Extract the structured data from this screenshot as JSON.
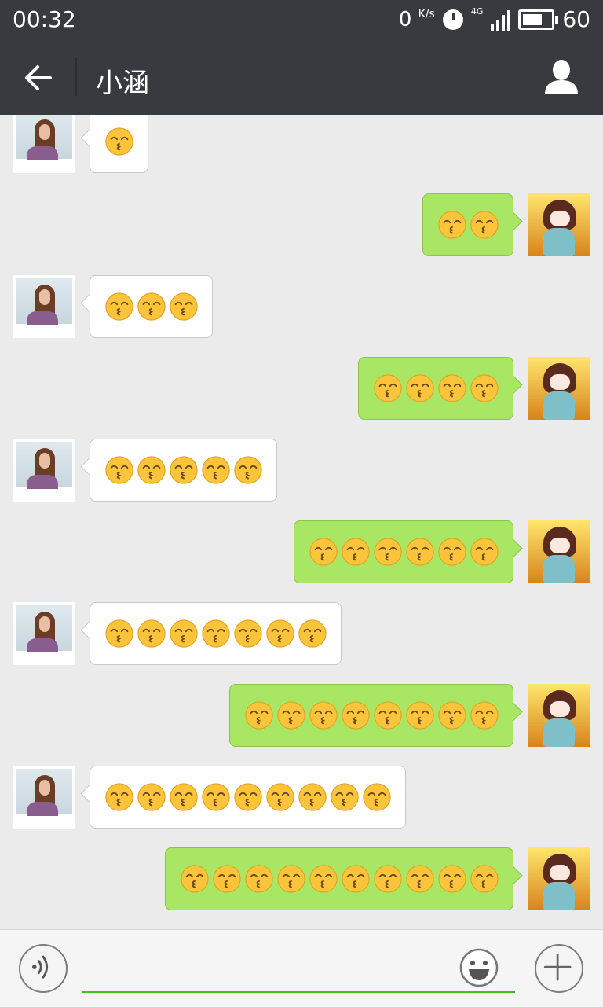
{
  "status": {
    "time": "00:32",
    "speed_value": "0",
    "speed_unit": "K/s",
    "network": "4G",
    "battery": "60"
  },
  "header": {
    "title": "小涵",
    "back_icon": "arrow-left-icon",
    "contact_icon": "person-icon"
  },
  "messages": [
    {
      "side": "left",
      "emoji_count": 1
    },
    {
      "side": "right",
      "emoji_count": 2
    },
    {
      "side": "left",
      "emoji_count": 3
    },
    {
      "side": "right",
      "emoji_count": 4
    },
    {
      "side": "left",
      "emoji_count": 5
    },
    {
      "side": "right",
      "emoji_count": 6
    },
    {
      "side": "left",
      "emoji_count": 7
    },
    {
      "side": "right",
      "emoji_count": 8
    },
    {
      "side": "left",
      "emoji_count": 9
    },
    {
      "side": "right",
      "emoji_count": 10
    }
  ],
  "message_emoji": "kissing-smiling-eyes-emoji",
  "input": {
    "value": "",
    "placeholder": ""
  },
  "colors": {
    "bar": "#393a3f",
    "chat_bg": "#ebebeb",
    "sent_bubble": "#a8e664",
    "received_bubble": "#ffffff",
    "input_underline": "#45c01a"
  }
}
